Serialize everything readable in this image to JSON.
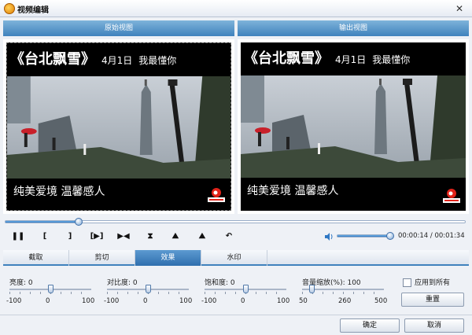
{
  "window": {
    "title": "视频编辑",
    "close_glyph": "✕"
  },
  "views": {
    "original_label": "原始视图",
    "output_label": "输出视图"
  },
  "video": {
    "caption_title": "《台北飘雪》",
    "caption_date": "4月1日",
    "caption_sub": "我最懂你",
    "caption_bottom": "纯美爱境 温馨感人",
    "logo": "sina-logo"
  },
  "playback": {
    "progress": 0.16,
    "volume": 0.95,
    "time": "00:00:14 / 00:01:34",
    "controls": [
      {
        "name": "pause-button",
        "glyph": "❚❚"
      },
      {
        "name": "mark-in-button",
        "glyph": "["
      },
      {
        "name": "mark-out-button",
        "glyph": "]"
      },
      {
        "name": "play-selection-button",
        "glyph": "[▶]"
      },
      {
        "name": "next-frame-button",
        "glyph": "▶◀"
      },
      {
        "name": "flip-vertical-button",
        "glyph": "⧗"
      },
      {
        "name": "mirror-button",
        "glyph": "⛰"
      },
      {
        "name": "rotate-button",
        "glyph": "⛰"
      },
      {
        "name": "undo-button",
        "glyph": "↶"
      }
    ]
  },
  "tabs": [
    {
      "label": "截取",
      "active": false
    },
    {
      "label": "剪切",
      "active": false
    },
    {
      "label": "效果",
      "active": true
    },
    {
      "label": "水印",
      "active": false
    }
  ],
  "effects": {
    "brightness": {
      "label": "亮度: 0",
      "min": "-100",
      "mid": "0",
      "max": "100",
      "value": 0,
      "range": [
        -100,
        100
      ]
    },
    "contrast": {
      "label": "对比度: 0",
      "min": "-100",
      "mid": "0",
      "max": "100",
      "value": 0,
      "range": [
        -100,
        100
      ]
    },
    "saturation": {
      "label": "饱和度: 0",
      "min": "-100",
      "mid": "0",
      "max": "100",
      "value": 0,
      "range": [
        -100,
        100
      ]
    },
    "volume_scale": {
      "label": "音量缩放(%): 100",
      "min": "50",
      "mid": "260",
      "max": "500",
      "value": 100,
      "range": [
        50,
        500
      ]
    },
    "apply_all_label": "应用到所有",
    "reset_label": "重置"
  },
  "footer": {
    "ok_label": "确定",
    "cancel_label": "取消"
  },
  "colors": {
    "accent": "#3f82bd",
    "header_top": "#7eb3da"
  }
}
